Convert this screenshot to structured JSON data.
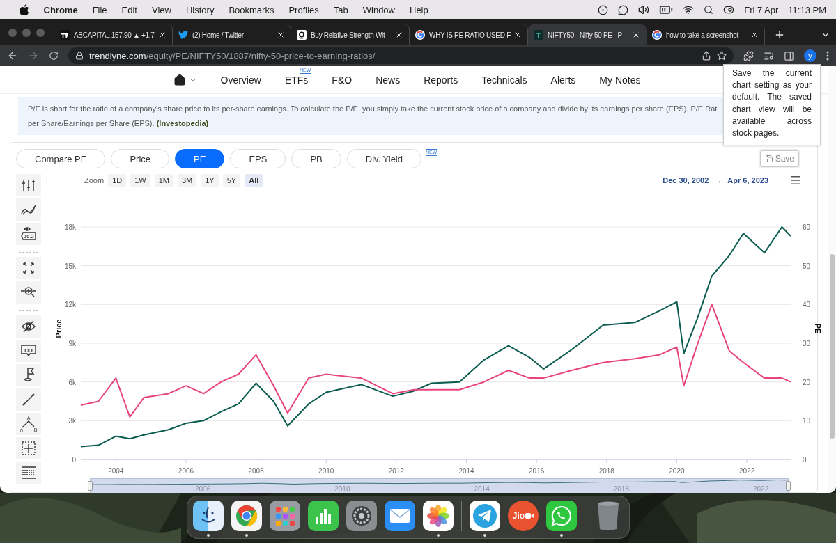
{
  "menubar": {
    "app": "Chrome",
    "items": [
      "File",
      "Edit",
      "View",
      "History",
      "Bookmarks",
      "Profiles",
      "Tab",
      "Window",
      "Help"
    ],
    "date": "Fri 7 Apr",
    "time": "11:13 PM"
  },
  "browser_tabs": [
    {
      "kind": "tt",
      "title": "ABCAPITAL 157.90 ▲ +1.7",
      "selected": false
    },
    {
      "kind": "bird",
      "title": "(2) Home / Twitter",
      "selected": false
    },
    {
      "kind": "a",
      "title": "Buy Relative Strength Wit",
      "selected": false
    },
    {
      "kind": "g",
      "title": "WHY IS PE RATIO USED F",
      "selected": false
    },
    {
      "kind": "t",
      "title": "NIFTY50 - Nifty 50 PE - P",
      "selected": true
    },
    {
      "kind": "g",
      "title": "how to take a screenshot",
      "selected": false
    }
  ],
  "address": {
    "domain": "trendlyne.com",
    "path": "/equity/PE/NIFTY50/1887/nifty-50-price-to-earning-ratios/",
    "avatar": "y"
  },
  "nav": [
    {
      "label": "Overview"
    },
    {
      "label": "ETFs",
      "badge": "NEW"
    },
    {
      "label": "F&O"
    },
    {
      "label": "News"
    },
    {
      "label": "Reports"
    },
    {
      "label": "Technicals"
    },
    {
      "label": "Alerts"
    },
    {
      "label": "My Notes"
    }
  ],
  "info": {
    "lines": [
      "P/E is short for the ratio of a company's share price to its per-share earnings. To calculate the P/E, you simply take the current stock price of a company and divide by its earnings per share (EPS). P/E Rati",
      "per Share/Earnings per Share (EPS). **(Investopedia)**"
    ]
  },
  "tooltip": "Save the current chart setting as your default. The saved chart view will be available across stock pages.",
  "chart_tabs": [
    {
      "label": "Compare PE",
      "selected": false
    },
    {
      "label": "Price",
      "selected": false
    },
    {
      "label": "PE",
      "selected": true
    },
    {
      "label": "EPS",
      "selected": false
    },
    {
      "label": "PB",
      "selected": false
    },
    {
      "label": "Div. Yield",
      "selected": false,
      "badge": "NEW"
    }
  ],
  "save_button": "Save",
  "tool_groups": [
    [
      {
        "kind": "indicators"
      },
      {
        "kind": "compare"
      },
      {
        "kind": "price-label",
        "label": "16.2"
      }
    ],
    [
      {
        "kind": "fullscreen"
      },
      {
        "kind": "zoom"
      }
    ],
    [
      {
        "kind": "hide"
      },
      {
        "kind": "text",
        "label": "TXT"
      },
      {
        "kind": "flag"
      },
      {
        "kind": "line"
      },
      {
        "kind": "pattern",
        "labels": [
          "A",
          "0",
          "B"
        ]
      },
      {
        "kind": "crosshair"
      },
      {
        "kind": "table"
      }
    ]
  ],
  "zoom": {
    "label": "Zoom",
    "buttons": [
      {
        "label": "1D",
        "selected": false
      },
      {
        "label": "1W",
        "selected": false
      },
      {
        "label": "1M",
        "selected": false
      },
      {
        "label": "3M",
        "selected": false
      },
      {
        "label": "1Y",
        "selected": false
      },
      {
        "label": "5Y",
        "selected": false
      },
      {
        "label": "All",
        "selected": true
      }
    ]
  },
  "range": {
    "from": "Dec 30, 2002",
    "arrow": "→",
    "to": "Apr 6, 2023"
  },
  "chart_data": {
    "type": "line",
    "ylabel": "Price",
    "y2label": "PE",
    "grid": true,
    "x": [
      2003,
      2003.5,
      2004,
      2004.4,
      2004.8,
      2005.5,
      2006,
      2006.5,
      2007,
      2007.5,
      2008,
      2008.5,
      2008.9,
      2009.5,
      2010,
      2011,
      2011.9,
      2012.5,
      2013,
      2013.8,
      2014.5,
      2015.2,
      2015.8,
      2016.2,
      2017,
      2017.9,
      2018.8,
      2019.5,
      2020,
      2020.2,
      2020.6,
      2021,
      2021.5,
      2021.9,
      2022.5,
      2023,
      2023.25
    ],
    "series": [
      {
        "color": "#0b5c50",
        "values": [
          1000,
          1100,
          1800,
          1600,
          1900,
          2300,
          2800,
          3000,
          3700,
          4300,
          5900,
          4500,
          2600,
          4300,
          5200,
          5800,
          4900,
          5300,
          5900,
          6000,
          7700,
          8800,
          7900,
          7000,
          8500,
          10400,
          10600,
          11500,
          12200,
          8200,
          11000,
          14200,
          15800,
          17500,
          16000,
          18000,
          17300
        ]
      },
      {
        "color": "#e8457f",
        "axis": "y2",
        "values": [
          14,
          15,
          21,
          11,
          16,
          17,
          19,
          17,
          20,
          22,
          27,
          19,
          12,
          21,
          22,
          21,
          17,
          18,
          18,
          18,
          20,
          23,
          21,
          21,
          23,
          25,
          26,
          27,
          29,
          19,
          30,
          40,
          28,
          25,
          21,
          21,
          20
        ]
      }
    ],
    "xlim": [
      2003,
      2023.27
    ],
    "ylim": [
      0,
      18000
    ],
    "y2lim": [
      0,
      60
    ],
    "xticks": [
      2004,
      2006,
      2008,
      2010,
      2012,
      2014,
      2016,
      2018,
      2020,
      2022
    ],
    "yticks": [
      {
        "value": 0,
        "label": "0"
      },
      {
        "value": 3000,
        "label": "3k"
      },
      {
        "value": 6000,
        "label": "6k"
      },
      {
        "value": 9000,
        "label": "9k"
      },
      {
        "value": 12000,
        "label": "12k"
      },
      {
        "value": 15000,
        "label": "15k"
      },
      {
        "value": 18000,
        "label": "18k"
      }
    ],
    "y2ticks": [
      0,
      10,
      20,
      30,
      40,
      50,
      60
    ]
  },
  "navigator": {
    "labels": [
      "2006",
      "2010",
      "2014",
      "2018",
      "2022"
    ]
  },
  "dock": [
    [
      {
        "kind": "finder",
        "running": true
      },
      {
        "kind": "chrome",
        "running": true
      },
      {
        "kind": "launchpad",
        "running": false
      },
      {
        "kind": "numbers",
        "running": false
      },
      {
        "kind": "settings",
        "running": false
      },
      {
        "kind": "mail",
        "running": false
      },
      {
        "kind": "photos",
        "running": true
      }
    ],
    [
      {
        "kind": "telegram",
        "running": true
      },
      {
        "kind": "jio",
        "label": "Jio",
        "running": false
      },
      {
        "kind": "whatsapp",
        "running": true
      }
    ],
    [
      {
        "kind": "trash",
        "running": false
      }
    ]
  ]
}
